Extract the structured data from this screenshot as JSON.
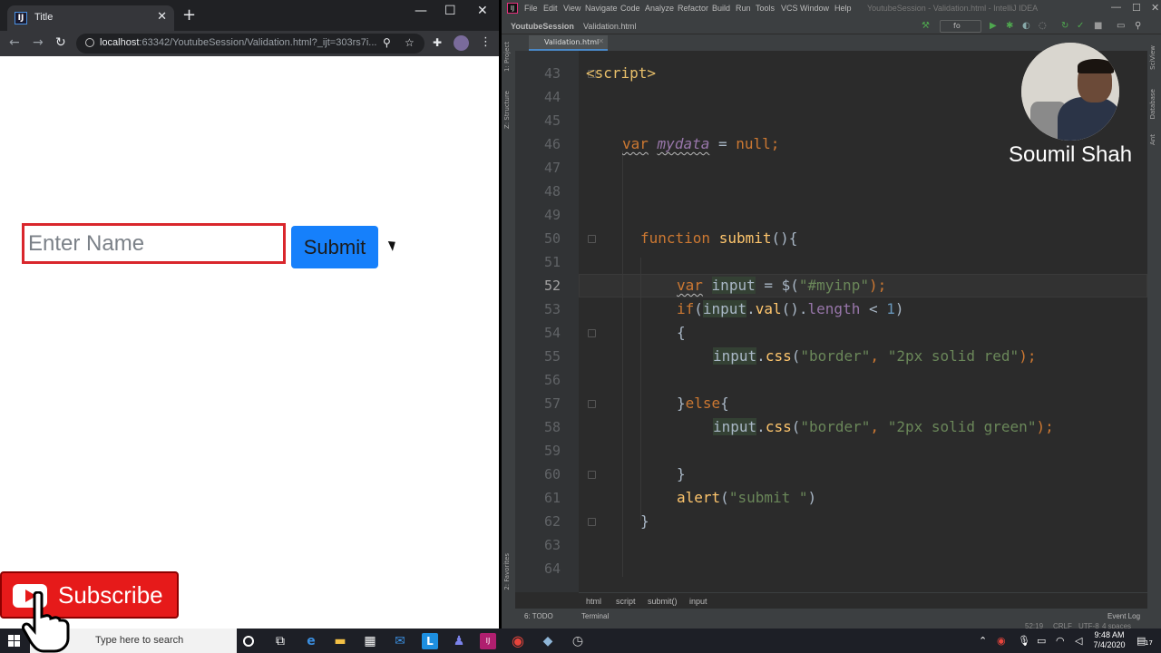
{
  "browser": {
    "tab_title": "Title",
    "tab_close": "✕",
    "new_tab": "+",
    "win_min": "—",
    "win_max": "☐",
    "win_close": "✕",
    "url_host": "localhost",
    "url_rest": ":63342/YoutubeSession/Validation.html?_ijt=303rs7i...",
    "icons": [
      "back-icon",
      "forward-icon",
      "reload-icon",
      "zoom-icon",
      "star-icon",
      "extensions-icon",
      "profile-avatar",
      "menu-icon"
    ]
  },
  "page": {
    "input_placeholder": "Enter Name",
    "input_value": "",
    "input_border_color": "#d9262c",
    "submit_label": "Submit",
    "submit_color": "#1680fb"
  },
  "overlay": {
    "subscribe_label": "Subscribe",
    "presenter_name": "Soumil Shah"
  },
  "ide": {
    "menu": [
      "File",
      "Edit",
      "View",
      "Navigate",
      "Code",
      "Analyze",
      "Refactor",
      "Build",
      "Run",
      "Tools",
      "VCS",
      "Window",
      "Help"
    ],
    "window_title": "YoutubeSession - Validation.html - IntelliJ IDEA",
    "project": "YoutubeSession",
    "file": "Validation.html",
    "tab_label": "Validation.html",
    "run_config": "fo",
    "left_tools": [
      "1: Project",
      "Z: Structure",
      "2: Favorites"
    ],
    "right_tools": [
      "SciView",
      "Database",
      "Ant"
    ],
    "line_numbers": [
      "43",
      "44",
      "45",
      "46",
      "47",
      "48",
      "49",
      "50",
      "51",
      "52",
      "53",
      "54",
      "55",
      "56",
      "57",
      "58",
      "59",
      "60",
      "61",
      "62",
      "63",
      "64"
    ],
    "current_line": "52",
    "code": {
      "l43": "<script>",
      "l46_kw": "var",
      "l46_name": "mydata",
      "l46_rest": " = ",
      "l46_null": "null",
      "l46_end": ";",
      "l50_kw": "function",
      "l50_fn": "submit",
      "l50_rest": "(){",
      "l52_kw": "var",
      "l52_name": "input",
      "l52_rest": " = $(",
      "l52_str": "\"#myinp\"",
      "l52_end": ");",
      "l53_kw": "if",
      "l53_open": "(",
      "l53_var": "input",
      "l53_dot": ".",
      "l53_fn": "val",
      "l53_mid": "().",
      "l53_prop": "length",
      "l53_op": " < ",
      "l53_num": "1",
      "l53_end": ")",
      "l54": "{",
      "l55_var": "input",
      "l55_dot": ".",
      "l55_fn": "css",
      "l55_open": "(",
      "l55_str1": "\"border\"",
      "l55_comma": ", ",
      "l55_str2": "\"2px solid red\"",
      "l55_end": ");",
      "l57_brace": "}",
      "l57_kw": "else",
      "l57_open": "{",
      "l58_var": "input",
      "l58_dot": ".",
      "l58_fn": "css",
      "l58_open": "(",
      "l58_str1": "\"border\"",
      "l58_comma": ", ",
      "l58_str2": "\"2px solid green\"",
      "l58_end": ");",
      "l60": "}",
      "l61_fn": "alert",
      "l61_open": "(",
      "l61_str": "\"submit \"",
      "l61_end": ")",
      "l62": "}"
    },
    "breadcrumbs": [
      "html",
      "script",
      "submit()",
      "input"
    ],
    "status": {
      "todo": "6: TODO",
      "terminal": "Terminal",
      "event_log": "Event Log",
      "position": "52:19",
      "line_sep": "CRLF",
      "encoding": "UTF-8",
      "indent": "4 spaces"
    }
  },
  "taskbar": {
    "search_placeholder": "Type here to search",
    "time": "9:48 AM",
    "date": "7/4/2020",
    "notification_count": "17"
  }
}
